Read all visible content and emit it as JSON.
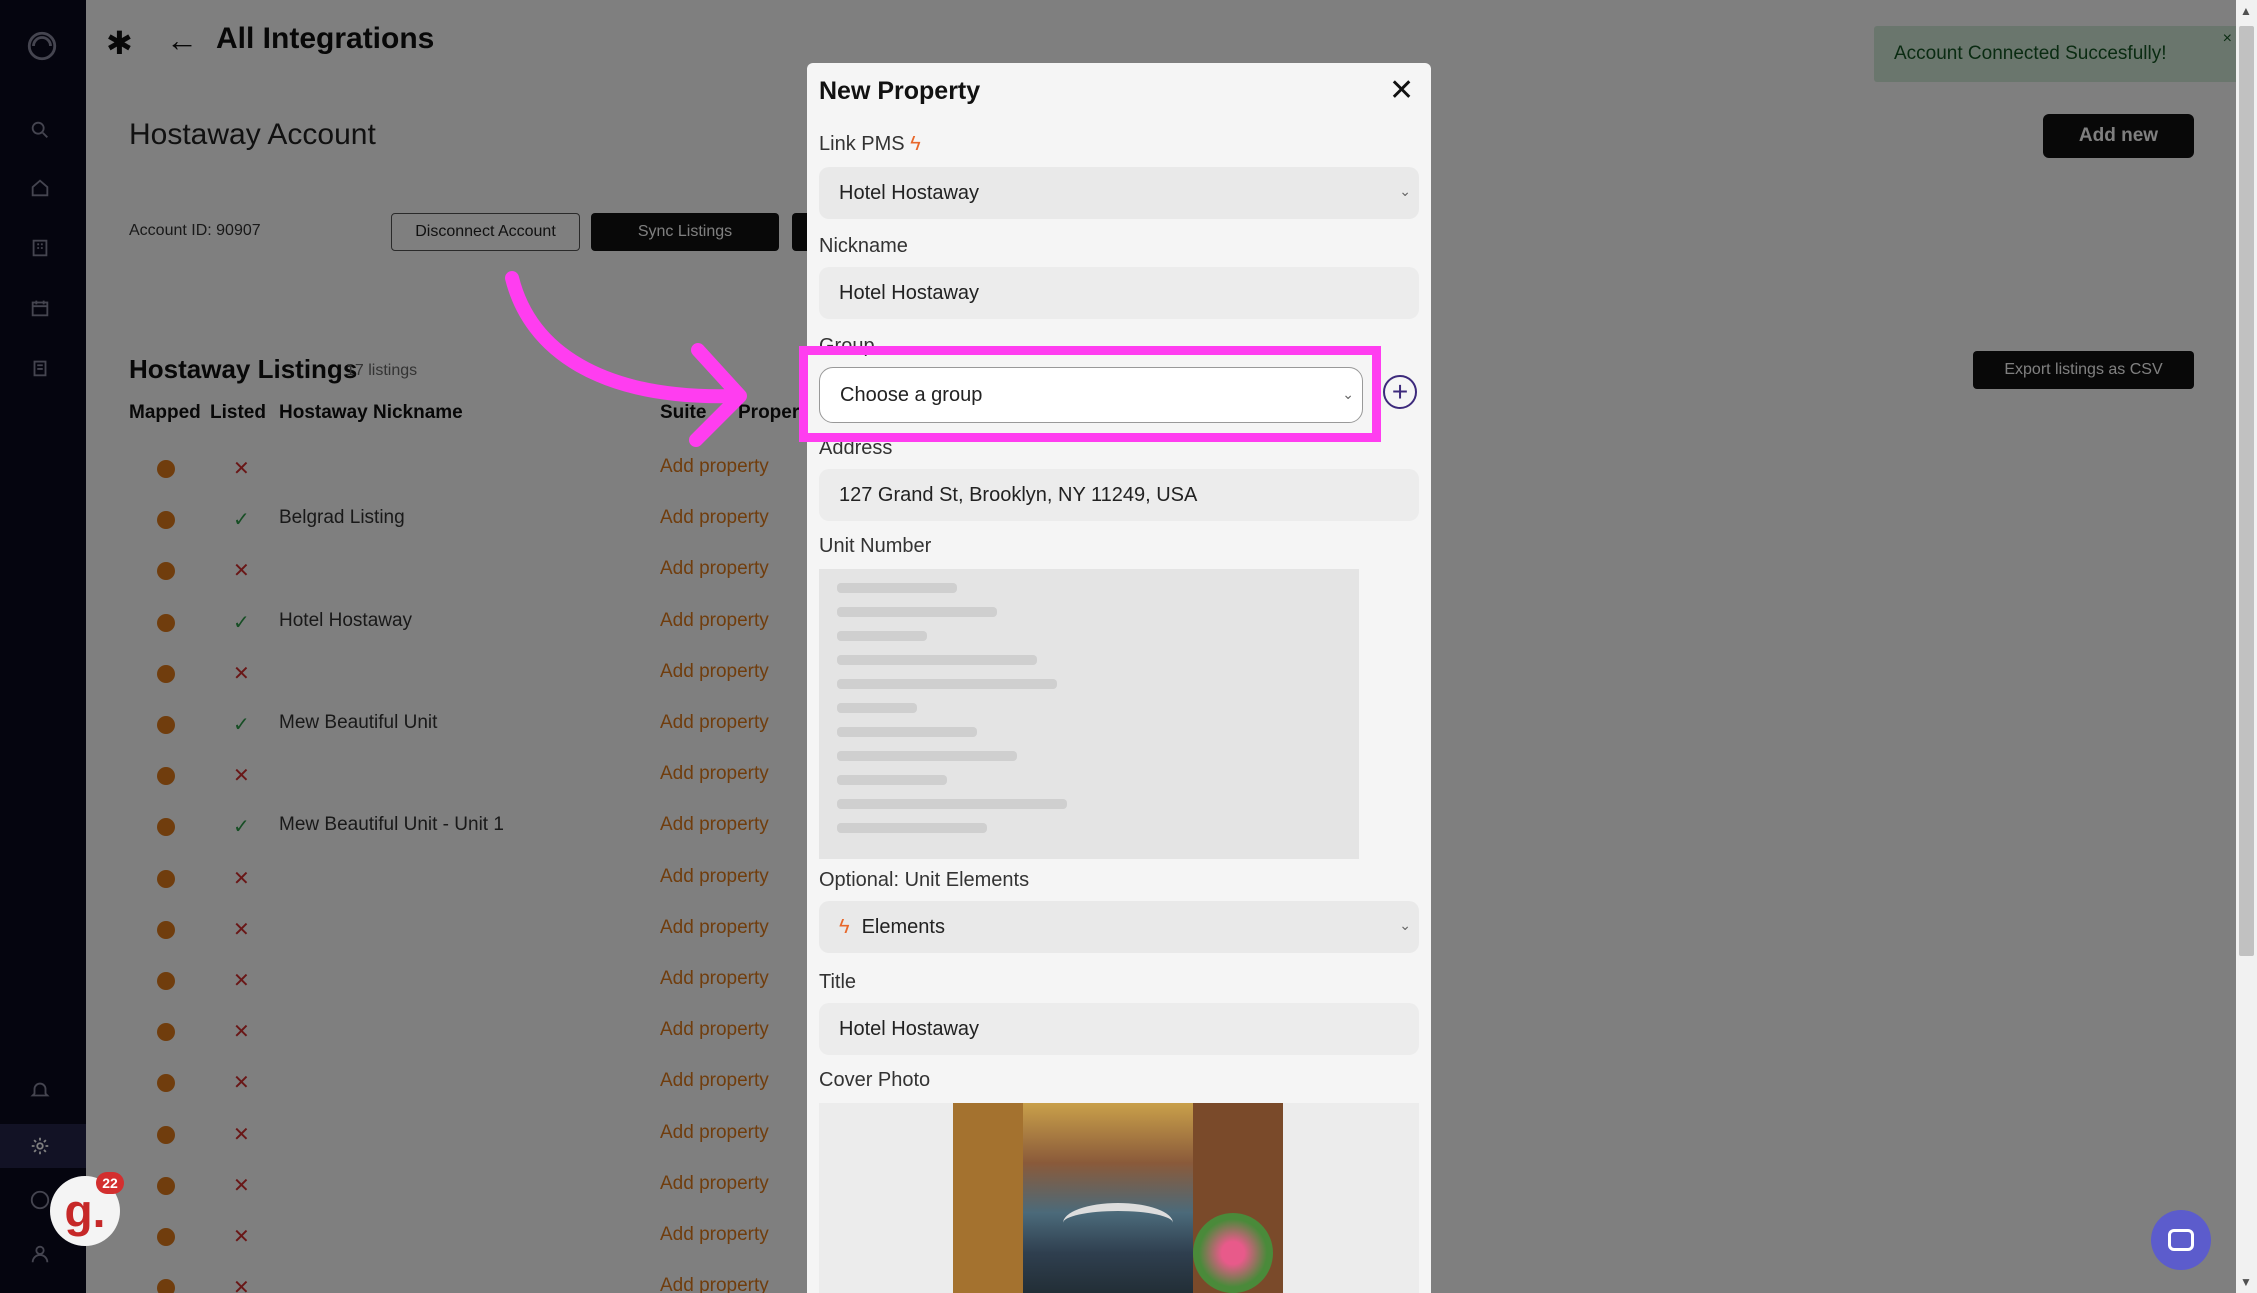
{
  "header": {
    "title": "All Integrations"
  },
  "account": {
    "title": "Hostaway Account",
    "account_id": "Account ID: 90907",
    "disconnect_label": "Disconnect Account",
    "sync_label": "Sync Listings",
    "add_new_label": "Add new",
    "export_label": "Export listings as CSV"
  },
  "toast": {
    "message": "Account Connected Succesfully!",
    "close": "×"
  },
  "listings": {
    "title": "Hostaway Listings",
    "count": "17 listings",
    "columns": [
      "Mapped",
      "Listed",
      "Hostaway Nickname",
      "Suite",
      "Proper"
    ],
    "rows": [
      {
        "listed": "x",
        "nickname": "",
        "action": "Add property"
      },
      {
        "listed": "ok",
        "nickname": "Belgrad Listing",
        "action": "Add property"
      },
      {
        "listed": "x",
        "nickname": "",
        "action": "Add property"
      },
      {
        "listed": "ok",
        "nickname": "Hotel Hostaway",
        "action": "Add property"
      },
      {
        "listed": "x",
        "nickname": "",
        "action": "Add property"
      },
      {
        "listed": "ok",
        "nickname": "Mew Beautiful Unit",
        "action": "Add property"
      },
      {
        "listed": "x",
        "nickname": "",
        "action": "Add property"
      },
      {
        "listed": "ok",
        "nickname": "Mew Beautiful Unit -  Unit 1",
        "action": "Add property"
      },
      {
        "listed": "x",
        "nickname": "",
        "action": "Add property"
      },
      {
        "listed": "x",
        "nickname": "",
        "action": "Add property"
      },
      {
        "listed": "x",
        "nickname": "",
        "action": "Add property"
      },
      {
        "listed": "x",
        "nickname": "",
        "action": "Add property"
      },
      {
        "listed": "x",
        "nickname": "",
        "action": "Add property"
      },
      {
        "listed": "x",
        "nickname": "",
        "action": "Add property"
      },
      {
        "listed": "x",
        "nickname": "",
        "action": "Add property"
      },
      {
        "listed": "x",
        "nickname": "",
        "action": "Add property"
      },
      {
        "listed": "x",
        "nickname": "",
        "action": "Add property"
      }
    ]
  },
  "modal": {
    "title": "New Property",
    "close": "✕",
    "link_pms_label": "Link PMS",
    "link_pms_value": "Hotel Hostaway",
    "nickname_label": "Nickname",
    "nickname_value": "Hotel Hostaway",
    "group_label": "Group",
    "group_placeholder": "Choose a group",
    "address_label": "Address",
    "address_value": "127 Grand St, Brooklyn, NY 11249, USA",
    "unit_number_label": "Unit Number",
    "unit_elements_label": "Optional: Unit Elements",
    "unit_elements_value": "Elements",
    "title_label": "Title",
    "title_value": "Hotel Hostaway",
    "cover_photo_label": "Cover Photo"
  },
  "avatar": {
    "letter": "g.",
    "badge": "22"
  },
  "colors": {
    "accent_orange": "#e07a1a",
    "highlight_magenta": "#ff3df0",
    "sidebar_bg": "#0b0b1f",
    "toast_bg": "#d4edda"
  }
}
